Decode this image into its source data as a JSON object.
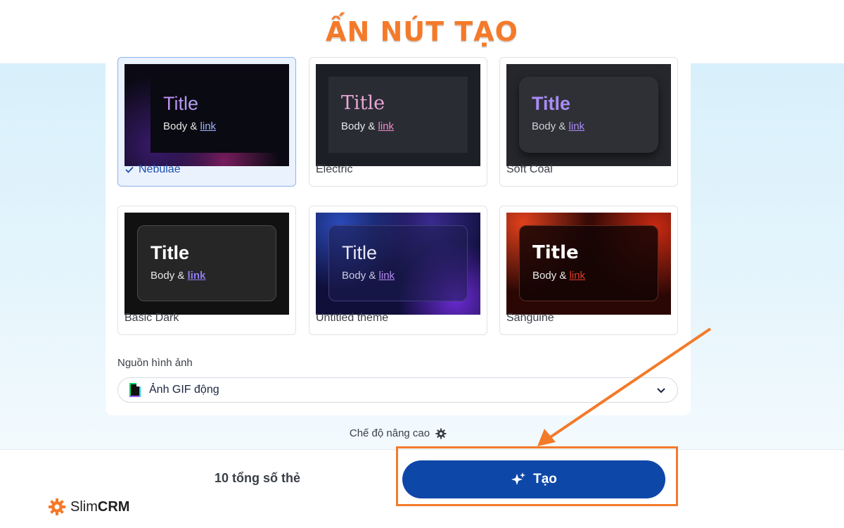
{
  "heading": "ẤN NÚT TẠO",
  "themes": [
    {
      "name": "Nebulae",
      "selected": true,
      "title": "Title",
      "body": "Body & ",
      "link": "link"
    },
    {
      "name": "Electric",
      "selected": false,
      "title": "Title",
      "body": "Body & ",
      "link": "link"
    },
    {
      "name": "Soft Coal",
      "selected": false,
      "title": "Title",
      "body": "Body & ",
      "link": "link"
    },
    {
      "name": "Basic Dark",
      "selected": false,
      "title": "Title",
      "body": "Body & ",
      "link": "link"
    },
    {
      "name": "Untitled theme",
      "selected": false,
      "title": "Title",
      "body": "Body & ",
      "link": "link"
    },
    {
      "name": "Sanguine",
      "selected": false,
      "title": "Title",
      "body": "Body & ",
      "link": "link"
    }
  ],
  "image_source": {
    "label": "Nguồn hình ảnh",
    "value": "Ảnh GIF động"
  },
  "advanced_mode": "Chế độ nâng cao",
  "footer": {
    "card_count": "10 tổng số thẻ",
    "create_label": "Tạo"
  },
  "brand": {
    "prefix": "Slim",
    "suffix": "CRM"
  },
  "colors": {
    "accent_orange": "#f47a2a",
    "primary_blue": "#0d47a8",
    "selected_border": "#8ab4f0"
  }
}
